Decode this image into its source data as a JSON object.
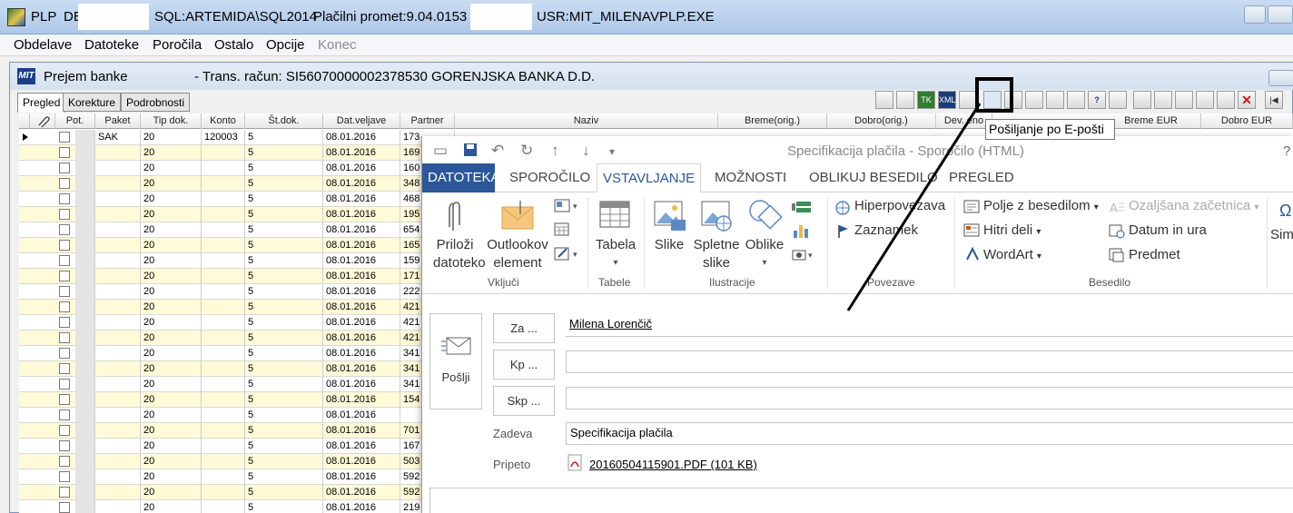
{
  "titlebar": {
    "app": "PLP",
    "db_prefix": "DE",
    "server": "SQL:ARTEMIDA\\SQL2014",
    "promet": "Plačilni promet:9.04.0153",
    "user": "USR:MIT_MILENA",
    "exe": "VPLP.EXE"
  },
  "menu": {
    "items": [
      "Obdelave",
      "Datoteke",
      "Poročila",
      "Ostalo",
      "Opcije"
    ],
    "disabled_item": "Konec"
  },
  "child": {
    "title": "Prejem banke",
    "account": "- Trans. račun: SI56070000002378530  GORENJSKA BANKA D.D.",
    "tabs": [
      "Pregled",
      "Korekture",
      "Podrobnosti"
    ],
    "active_tab": "Pregled"
  },
  "tooltip": "Pošiljanje po E-pošti",
  "grid": {
    "columns": [
      "Pot.",
      "Paket",
      "Tip dok.",
      "Konto",
      "Št.dok.",
      "Dat.veljave",
      "Partner",
      "Naziv",
      "Breme(orig.)",
      "Dobro(orig.)",
      "Dev. eno",
      "Breme EUR",
      "Dobro EUR"
    ],
    "rows": [
      {
        "paket": "SAK",
        "tip": "20",
        "konto": "120003",
        "st": "5",
        "dat": "08.01.2016",
        "partner": "173"
      },
      {
        "paket": "",
        "tip": "20",
        "konto": "",
        "st": "5",
        "dat": "08.01.2016",
        "partner": "169"
      },
      {
        "paket": "",
        "tip": "20",
        "konto": "",
        "st": "5",
        "dat": "08.01.2016",
        "partner": "160"
      },
      {
        "paket": "",
        "tip": "20",
        "konto": "",
        "st": "5",
        "dat": "08.01.2016",
        "partner": "348"
      },
      {
        "paket": "",
        "tip": "20",
        "konto": "",
        "st": "5",
        "dat": "08.01.2016",
        "partner": "468"
      },
      {
        "paket": "",
        "tip": "20",
        "konto": "",
        "st": "5",
        "dat": "08.01.2016",
        "partner": "195"
      },
      {
        "paket": "",
        "tip": "20",
        "konto": "",
        "st": "5",
        "dat": "08.01.2016",
        "partner": "654"
      },
      {
        "paket": "",
        "tip": "20",
        "konto": "",
        "st": "5",
        "dat": "08.01.2016",
        "partner": "165"
      },
      {
        "paket": "",
        "tip": "20",
        "konto": "",
        "st": "5",
        "dat": "08.01.2016",
        "partner": "159"
      },
      {
        "paket": "",
        "tip": "20",
        "konto": "",
        "st": "5",
        "dat": "08.01.2016",
        "partner": "171"
      },
      {
        "paket": "",
        "tip": "20",
        "konto": "",
        "st": "5",
        "dat": "08.01.2016",
        "partner": "222"
      },
      {
        "paket": "",
        "tip": "20",
        "konto": "",
        "st": "5",
        "dat": "08.01.2016",
        "partner": "421"
      },
      {
        "paket": "",
        "tip": "20",
        "konto": "",
        "st": "5",
        "dat": "08.01.2016",
        "partner": "421"
      },
      {
        "paket": "",
        "tip": "20",
        "konto": "",
        "st": "5",
        "dat": "08.01.2016",
        "partner": "421"
      },
      {
        "paket": "",
        "tip": "20",
        "konto": "",
        "st": "5",
        "dat": "08.01.2016",
        "partner": "341"
      },
      {
        "paket": "",
        "tip": "20",
        "konto": "",
        "st": "5",
        "dat": "08.01.2016",
        "partner": "341"
      },
      {
        "paket": "",
        "tip": "20",
        "konto": "",
        "st": "5",
        "dat": "08.01.2016",
        "partner": "341"
      },
      {
        "paket": "",
        "tip": "20",
        "konto": "",
        "st": "5",
        "dat": "08.01.2016",
        "partner": "154"
      },
      {
        "paket": "",
        "tip": "20",
        "konto": "",
        "st": "5",
        "dat": "08.01.2016",
        "partner": ""
      },
      {
        "paket": "",
        "tip": "20",
        "konto": "",
        "st": "5",
        "dat": "08.01.2016",
        "partner": "701"
      },
      {
        "paket": "",
        "tip": "20",
        "konto": "",
        "st": "5",
        "dat": "08.01.2016",
        "partner": "167"
      },
      {
        "paket": "",
        "tip": "20",
        "konto": "",
        "st": "5",
        "dat": "08.01.2016",
        "partner": "503"
      },
      {
        "paket": "",
        "tip": "20",
        "konto": "",
        "st": "5",
        "dat": "08.01.2016",
        "partner": "592"
      },
      {
        "paket": "",
        "tip": "20",
        "konto": "",
        "st": "5",
        "dat": "08.01.2016",
        "partner": "592"
      },
      {
        "paket": "",
        "tip": "20",
        "konto": "",
        "st": "5",
        "dat": "08.01.2016",
        "partner": "219"
      }
    ]
  },
  "outlook": {
    "window_title": "Specifikacija plačila - Sporočilo (HTML)",
    "help": "?",
    "tabs": [
      "DATOTEKA",
      "SPOROČILO",
      "VSTAVLJANJE",
      "MOŽNOSTI",
      "OBLIKUJ BESEDILO",
      "PREGLED"
    ],
    "active_tab": "VSTAVLJANJE",
    "ribbon": {
      "vkljuci": {
        "label": "Vključi",
        "attach_1": "Priloži",
        "attach_2": "datoteko",
        "item_1": "Outlookov",
        "item_2": "element"
      },
      "tabele": {
        "label": "Tabele",
        "table": "Tabela"
      },
      "ilustracije": {
        "label": "Ilustracije",
        "pictures": "Slike",
        "online_1": "Spletne",
        "online_2": "slike",
        "shapes": "Oblike"
      },
      "povezave": {
        "label": "Povezave",
        "hyperlink": "Hiperpovezava",
        "bookmark": "Zaznamek"
      },
      "besedilo": {
        "label": "Besedilo",
        "textbox": "Polje z besedilom",
        "quickparts": "Hitri deli",
        "wordart": "WordArt",
        "dropcap": "Ozaljšana začetnica",
        "datetime": "Datum in ura",
        "object": "Predmet"
      },
      "symbols": "Sim"
    },
    "compose": {
      "send": "Pošlji",
      "to_btn": "Za ...",
      "cc_btn": "Kp ...",
      "bcc_btn": "Skp ...",
      "to_value": "Milena Lorenčič",
      "subject_label": "Zadeva",
      "subject": "Specifikacija plačila",
      "attached_label": "Pripeto",
      "attachment": "20160504115901.PDF (101 KB)"
    }
  }
}
